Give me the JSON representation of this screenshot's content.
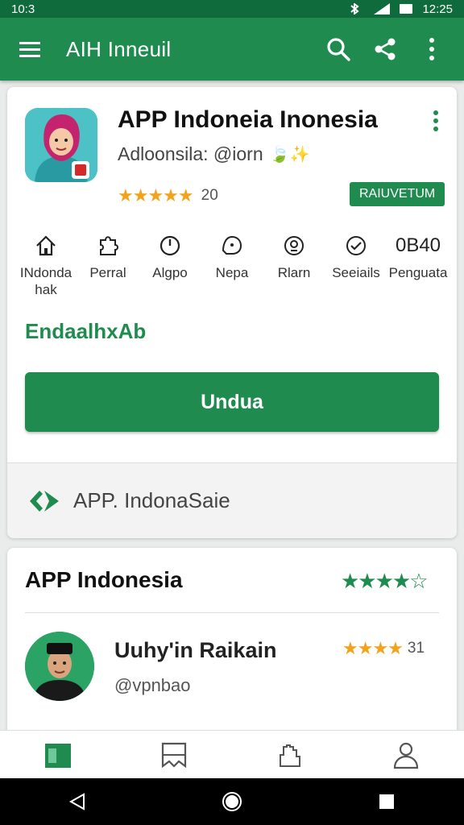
{
  "status_bar": {
    "time": "10:3",
    "clock": "12:25"
  },
  "app_bar": {
    "title": "AIH Inneuil",
    "icons": [
      "menu-icon",
      "search-icon",
      "share-icon",
      "more-vert-icon"
    ]
  },
  "app": {
    "name": "APP Indoneia Inonesia",
    "developer": "Adloonsila: @iorn",
    "dev_emoji": "🍃✨",
    "rating_stars": "★★★★★",
    "rating_count": "20",
    "badge": "RAIUVETUM",
    "features": [
      {
        "icon": "home-icon",
        "label": "INdonda hak"
      },
      {
        "icon": "puzzle-icon",
        "label": "Perral"
      },
      {
        "icon": "clock-icon",
        "label": "Algpo"
      },
      {
        "icon": "chat-icon",
        "label": "Nepa"
      },
      {
        "icon": "badge-icon",
        "label": "Rlarn"
      },
      {
        "icon": "check-icon",
        "label": "Seeiails"
      },
      {
        "code": "0B40",
        "label": "Penguata"
      }
    ],
    "link_text": "EndaalhxAb",
    "install_label": "Undua",
    "promo_text": "APP. IndonaSaie"
  },
  "reviews": {
    "title": "APP Indonesia",
    "stars": "★★★★☆",
    "reviewer": {
      "name": "Uuhy'in Raikain",
      "handle": "@vpnbao",
      "stars": "★★★★",
      "count": "31"
    }
  },
  "colors": {
    "primary": "#1f8b4f",
    "status": "#0f6b3b",
    "star": "#f2a31b"
  },
  "bottom_nav": [
    "apps-icon",
    "bookmark-icon",
    "hand-icon",
    "account-icon"
  ]
}
